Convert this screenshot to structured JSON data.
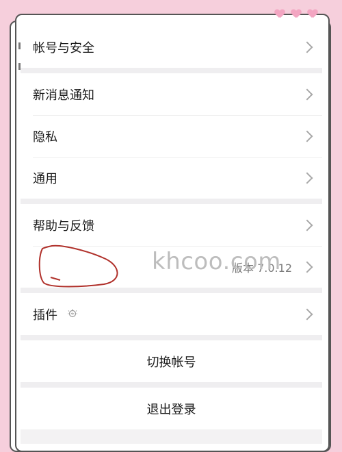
{
  "settings": {
    "account_security": "帐号与安全",
    "new_message_notify": "新消息通知",
    "privacy": "隐私",
    "general": "通用",
    "help_feedback": "帮助与反馈",
    "about_version": "版本 7.0.12",
    "plugins": "插件",
    "switch_account": "切换帐号",
    "logout": "退出登录"
  },
  "watermark": "khcoo.com",
  "colors": {
    "page_bg": "#f6cfdc",
    "heart": "#f3a6c2",
    "scribble": "#b0302a"
  }
}
